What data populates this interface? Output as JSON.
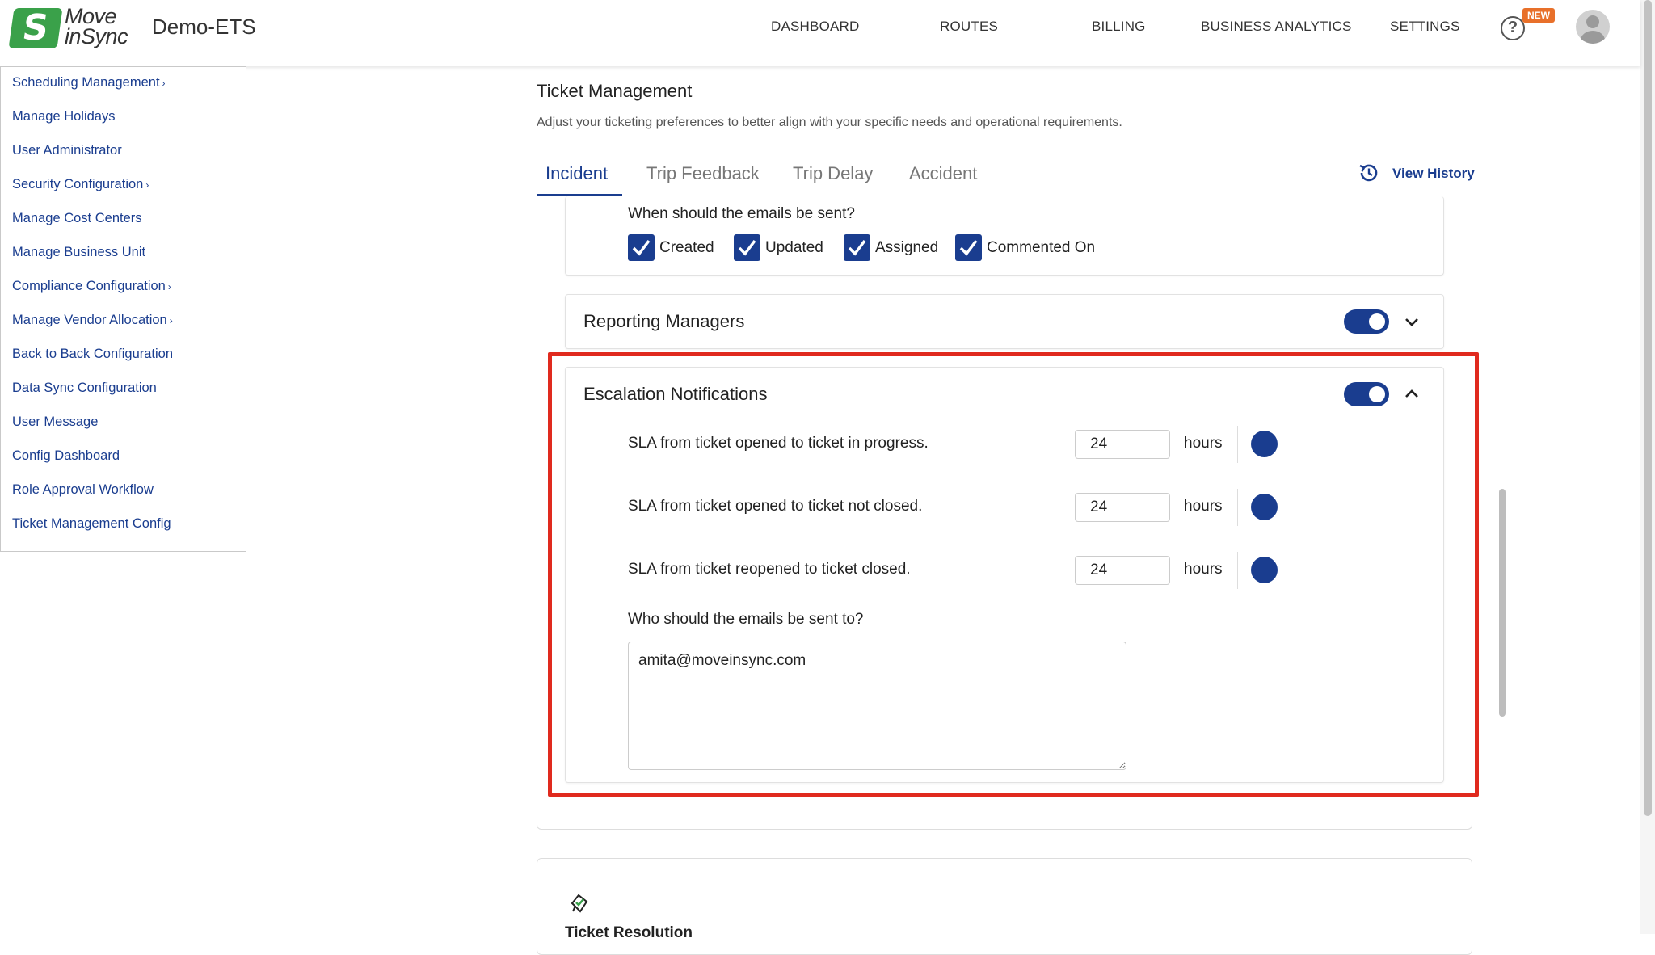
{
  "header": {
    "logo_mark": "S",
    "logo_line1": "Move",
    "logo_line2": "inSync",
    "app_name": "Demo-ETS",
    "nav": [
      "DASHBOARD",
      "ROUTES",
      "BILLING",
      "BUSINESS ANALYTICS",
      "SETTINGS"
    ],
    "help_glyph": "?",
    "new_badge": "NEW"
  },
  "sidebar": {
    "items": [
      {
        "label": "Scheduling Management",
        "has_submenu": true
      },
      {
        "label": "Manage Holidays",
        "has_submenu": false
      },
      {
        "label": "User Administrator",
        "has_submenu": false
      },
      {
        "label": "Security Configuration",
        "has_submenu": true
      },
      {
        "label": "Manage Cost Centers",
        "has_submenu": false
      },
      {
        "label": "Manage Business Unit",
        "has_submenu": false
      },
      {
        "label": "Compliance Configuration",
        "has_submenu": true
      },
      {
        "label": "Manage Vendor Allocation",
        "has_submenu": true
      },
      {
        "label": "Back to Back Configuration",
        "has_submenu": false
      },
      {
        "label": "Data Sync Configuration",
        "has_submenu": false
      },
      {
        "label": "User Message",
        "has_submenu": false
      },
      {
        "label": "Config Dashboard",
        "has_submenu": false
      },
      {
        "label": "Role Approval Workflow",
        "has_submenu": false
      },
      {
        "label": "Ticket Management Config",
        "has_submenu": false
      }
    ],
    "chevron_glyph": "›"
  },
  "main": {
    "title": "Ticket Management",
    "description": "Adjust your ticketing preferences to better align with your specific needs and operational requirements.",
    "tabs": [
      {
        "label": "Incident",
        "active": true
      },
      {
        "label": "Trip Feedback",
        "active": false
      },
      {
        "label": "Trip Delay",
        "active": false
      },
      {
        "label": "Accident",
        "active": false
      }
    ],
    "view_history_label": "View History",
    "email_timing": {
      "question": "When should the emails be sent?",
      "options": [
        {
          "label": "Created",
          "checked": true
        },
        {
          "label": "Updated",
          "checked": true
        },
        {
          "label": "Assigned",
          "checked": true
        },
        {
          "label": "Commented On",
          "checked": true
        }
      ]
    },
    "reporting_managers": {
      "title": "Reporting Managers",
      "enabled": true,
      "expanded": false
    },
    "escalation": {
      "title": "Escalation Notifications",
      "enabled": true,
      "expanded": true,
      "slas": [
        {
          "label": "SLA from ticket opened to ticket in progress.",
          "value": "24",
          "unit": "hours",
          "enabled": true
        },
        {
          "label": "SLA from ticket opened to ticket not closed.",
          "value": "24",
          "unit": "hours",
          "enabled": true
        },
        {
          "label": "SLA from ticket reopened to ticket closed.",
          "value": "24",
          "unit": "hours",
          "enabled": true
        }
      ],
      "recipients_question": "Who should the emails be sent to?",
      "recipients_value": "amita@moveinsync.com"
    },
    "ticket_resolution_title": "Ticket Resolution"
  },
  "colors": {
    "primary": "#1a3d8f",
    "brand_green": "#3aa14a",
    "highlight_red": "#e02a1e",
    "badge_orange": "#e8702a"
  },
  "icons": [
    "logo-icon",
    "help-icon",
    "avatar-icon",
    "history-icon",
    "checkbox-check-icon",
    "chevron-down-icon",
    "chevron-up-icon",
    "ticket-icon",
    "submenu-chevron-icon"
  ]
}
